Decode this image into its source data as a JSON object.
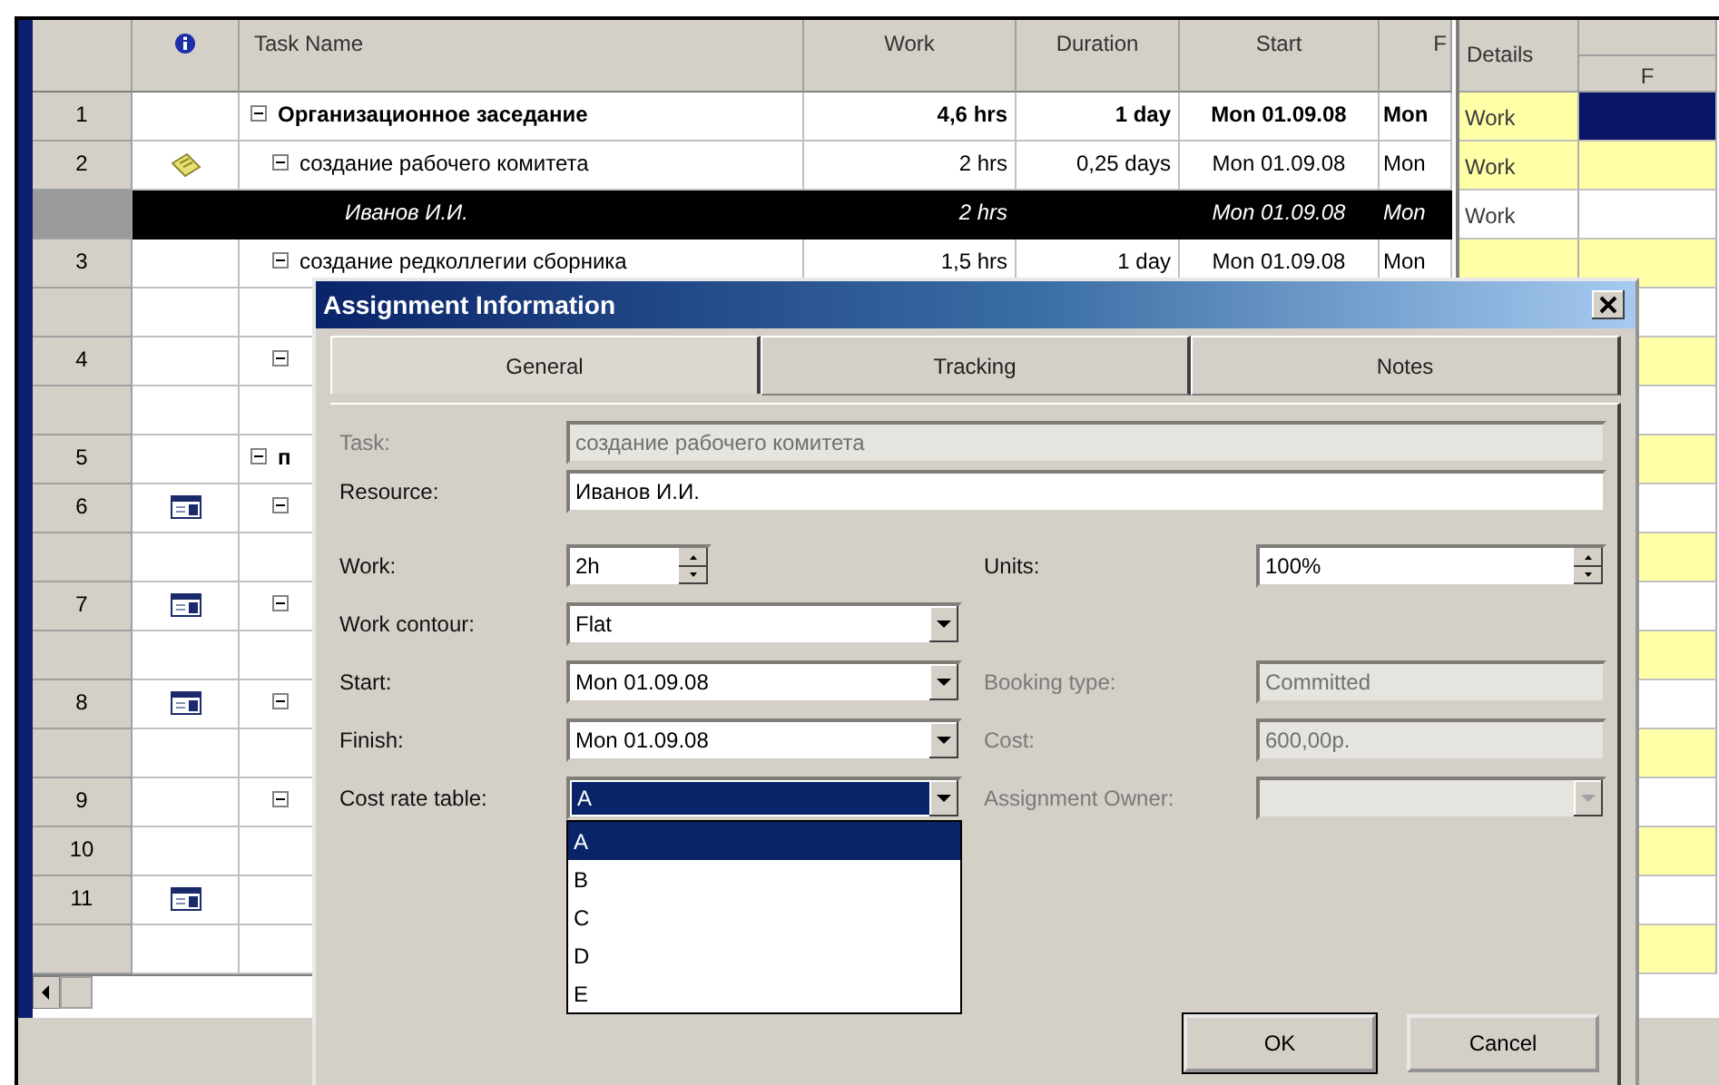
{
  "table": {
    "columns": [
      "Task Name",
      "Work",
      "Duration",
      "Start",
      "F"
    ],
    "tasks": [
      {
        "kind": "task",
        "number": "1",
        "name": "Организационное заседание",
        "summary": true,
        "expanded": true,
        "selected": false,
        "work": "4,6 hrs",
        "duration": "1 day",
        "start": "Mon 01.09.08",
        "finish": "Mon",
        "children": [
          {
            "kind": "task",
            "number": "2",
            "indicator": {
              "kind": "note"
            },
            "name": "создание рабочего комитета",
            "summary": false,
            "expanded": true,
            "selected": false,
            "work": "2 hrs",
            "duration": "0,25 days",
            "start": "Mon 01.09.08",
            "finish": "Mon",
            "children": [
              {
                "kind": "assignment",
                "name": "Иванов И.И.",
                "selected": true,
                "work": "2 hrs",
                "start": "Mon 01.09.08",
                "finish": "Mon"
              }
            ]
          },
          {
            "kind": "task",
            "number": "3",
            "name": "создание редколлегии сборника",
            "summary": false,
            "expanded": true,
            "selected": false,
            "work": "1,5 hrs",
            "duration": "1 day",
            "start": "Mon 01.09.08",
            "finish": "Mon"
          },
          {
            "kind": "blank"
          },
          {
            "kind": "task",
            "number": "4",
            "expanded": true,
            "selected": false
          },
          {
            "kind": "blank"
          }
        ]
      },
      {
        "kind": "task",
        "number": "5",
        "name": "п",
        "summary": true,
        "expanded": true,
        "selected": false,
        "children": [
          {
            "kind": "task",
            "number": "6",
            "indicator": {
              "kind": "calendar"
            },
            "expanded": true,
            "selected": false
          },
          {
            "kind": "blank"
          },
          {
            "kind": "task",
            "number": "7",
            "indicator": {
              "kind": "calendar"
            },
            "expanded": true,
            "selected": false
          },
          {
            "kind": "blank"
          },
          {
            "kind": "task",
            "number": "8",
            "indicator": {
              "kind": "calendar"
            },
            "expanded": true,
            "selected": false
          },
          {
            "kind": "blank"
          },
          {
            "kind": "task",
            "number": "9",
            "expanded": true,
            "selected": false,
            "children": [
              {
                "kind": "task",
                "number": "10",
                "selected": false
              },
              {
                "kind": "task",
                "number": "11",
                "indicator": {
                  "kind": "calendar"
                },
                "selected": false
              },
              {
                "kind": "blank"
              }
            ]
          }
        ]
      }
    ]
  },
  "details": {
    "title": "Details",
    "column": "F",
    "rows": [
      {
        "label": "Work",
        "shaded": true,
        "selected": true
      },
      {
        "label": "Work",
        "shaded": true,
        "selected": false
      },
      {
        "label": "Work",
        "shaded": false,
        "selected": false
      },
      {
        "shaded": true,
        "selected": false
      },
      {
        "shaded": false,
        "selected": false
      },
      {
        "shaded": true,
        "selected": false
      },
      {
        "shaded": false,
        "selected": false
      },
      {
        "shaded": true,
        "selected": false
      },
      {
        "shaded": false,
        "selected": false
      },
      {
        "shaded": true,
        "selected": false
      },
      {
        "shaded": false,
        "selected": false
      },
      {
        "shaded": true,
        "selected": false
      },
      {
        "shaded": false,
        "selected": false
      },
      {
        "shaded": true,
        "selected": false
      },
      {
        "shaded": false,
        "selected": false
      },
      {
        "shaded": true,
        "selected": false
      },
      {
        "shaded": false,
        "selected": false
      },
      {
        "shaded": true,
        "selected": false
      }
    ]
  },
  "dialog": {
    "title": "Assignment Information",
    "tabs": [
      {
        "label": "General",
        "selected": true
      },
      {
        "label": "Tracking",
        "selected": false
      },
      {
        "label": "Notes",
        "selected": false
      }
    ],
    "wide_fields": [
      {
        "label": "Task:",
        "kind": "text",
        "value": "создание рабочего комитета",
        "disabled": true
      },
      {
        "label": "Resource:",
        "kind": "text",
        "value": "Иванов И.И.",
        "disabled": false
      }
    ],
    "rows": [
      {
        "left": {
          "label": "Work:",
          "kind": "spin",
          "value": "2h",
          "disabled": false
        },
        "right": {
          "label": "Units:",
          "kind": "spin",
          "value": "100%",
          "disabled": false
        }
      },
      {
        "left": {
          "label": "Work contour:",
          "kind": "combo",
          "value": "Flat",
          "disabled": false
        }
      },
      {
        "left": {
          "label": "Start:",
          "kind": "combo",
          "value": "Mon 01.09.08",
          "disabled": false
        },
        "right": {
          "label": "Booking type:",
          "kind": "text",
          "value": "Committed",
          "disabled": true
        }
      },
      {
        "left": {
          "label": "Finish:",
          "kind": "combo",
          "value": "Mon 01.09.08",
          "disabled": false
        },
        "right": {
          "label": "Cost:",
          "kind": "text",
          "value": "600,00р.",
          "disabled": true
        }
      },
      {
        "left": {
          "label": "Cost rate table:",
          "kind": "combo",
          "value": "A",
          "disabled": false,
          "highlighted": true,
          "expanded": true,
          "options": [
            {
              "label": "A",
              "selected": true
            },
            {
              "label": "B",
              "selected": false
            },
            {
              "label": "C",
              "selected": false
            },
            {
              "label": "D",
              "selected": false
            },
            {
              "label": "E",
              "selected": false
            }
          ]
        },
        "right": {
          "label": "Assignment Owner:",
          "kind": "combo",
          "disabled": true
        }
      }
    ],
    "buttons": [
      "OK",
      "Cancel"
    ]
  }
}
